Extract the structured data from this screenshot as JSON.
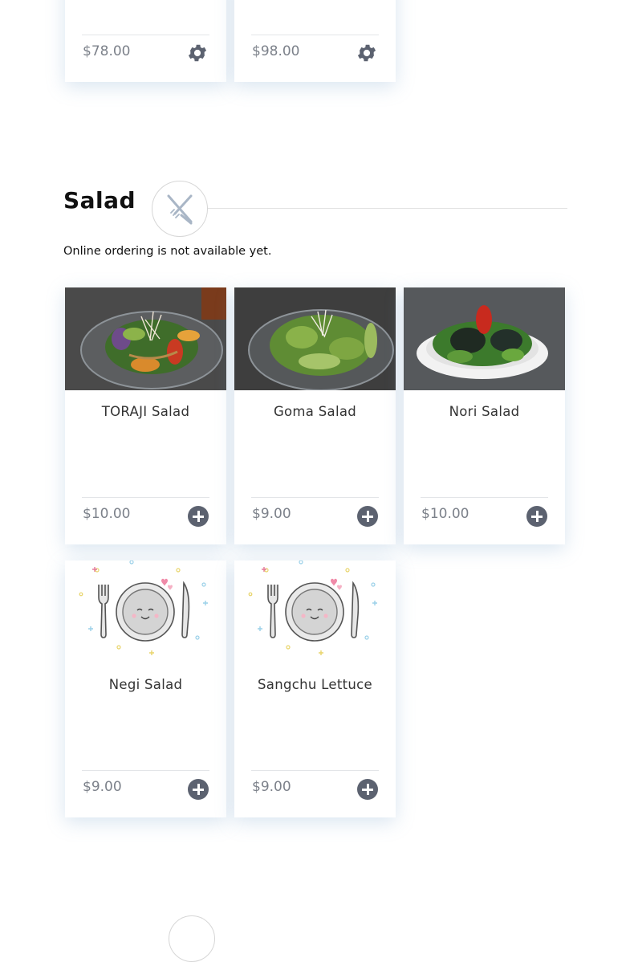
{
  "previous_section": {
    "items": [
      {
        "price": "$78.00",
        "action_icon": "gear-icon"
      },
      {
        "price": "$98.00",
        "action_icon": "gear-icon"
      }
    ]
  },
  "salad_section": {
    "title": "Salad",
    "section_icon": "fork-knife-icon",
    "notice": "Online ordering is not available yet.",
    "items": [
      {
        "name": "TORAJI Salad",
        "price": "$10.00",
        "image": "toraji-salad-photo",
        "action_icon": "plus-circle-icon"
      },
      {
        "name": "Goma Salad",
        "price": "$9.00",
        "image": "goma-salad-photo",
        "action_icon": "plus-circle-icon"
      },
      {
        "name": "Nori Salad",
        "price": "$10.00",
        "image": "nori-salad-photo",
        "action_icon": "plus-circle-icon"
      },
      {
        "name": "Negi Salad",
        "price": "$9.00",
        "image": "plate-placeholder-illustration",
        "action_icon": "plus-circle-icon"
      },
      {
        "name": "Sangchu Lettuce",
        "price": "$9.00",
        "image": "plate-placeholder-illustration",
        "action_icon": "plus-circle-icon"
      }
    ]
  },
  "colors": {
    "action_button": "#5c6270",
    "price_text": "#7c818a",
    "card_shadow": "#c8d8e8"
  }
}
